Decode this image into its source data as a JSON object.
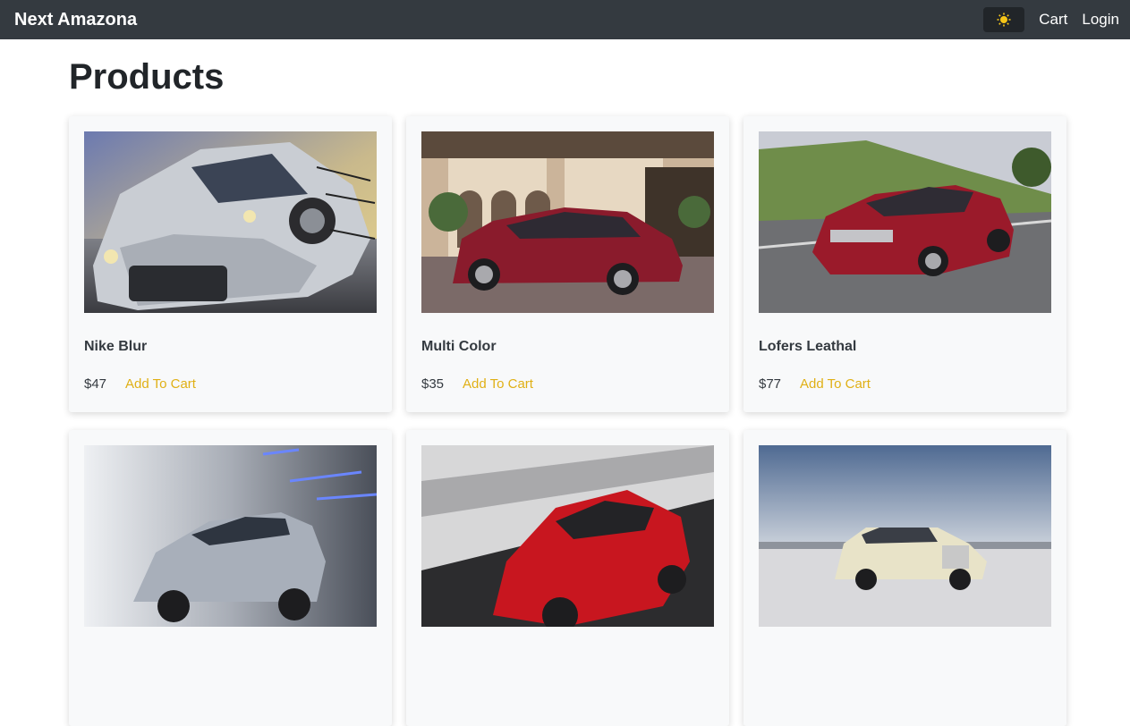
{
  "navbar": {
    "brand": "Next Amazona",
    "theme_icon": "sun-icon",
    "cart_label": "Cart",
    "login_label": "Login"
  },
  "page": {
    "title": "Products"
  },
  "products": [
    {
      "name": "Nike Blur",
      "price": "$47",
      "button": "Add To Cart",
      "image": "silver-race-car"
    },
    {
      "name": "Multi Color",
      "price": "$35",
      "button": "Add To Cart",
      "image": "red-sedan-villa"
    },
    {
      "name": "Lofers Leathal",
      "price": "$77",
      "button": "Add To Cart",
      "image": "red-sedan-road"
    },
    {
      "name": "",
      "price": "",
      "button": "",
      "image": "silver-hatchback-tunnel"
    },
    {
      "name": "",
      "price": "",
      "button": "",
      "image": "red-hatchback"
    },
    {
      "name": "",
      "price": "",
      "button": "",
      "image": "white-luxury-car"
    }
  ],
  "colors": {
    "navbar": "#343a40",
    "accent": "#e0b015"
  }
}
